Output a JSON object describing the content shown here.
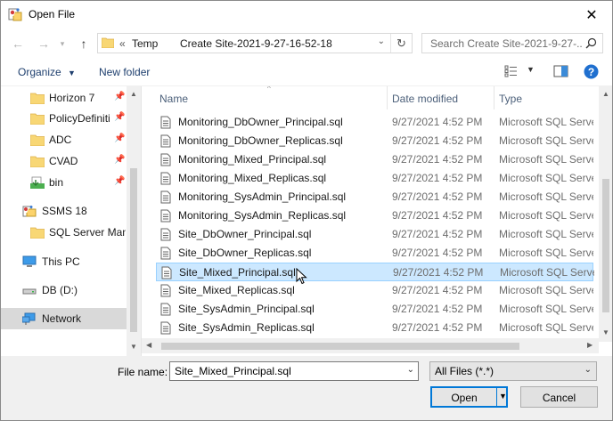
{
  "window": {
    "title": "Open File"
  },
  "address": {
    "prefix": "«",
    "segments": [
      "Temp",
      "Create Site-2021-9-27-16-52-18"
    ],
    "search_placeholder": "Search Create Site-2021-9-27-..."
  },
  "toolbar": {
    "organize": "Organize",
    "new_folder": "New folder"
  },
  "sidebar": {
    "items": [
      {
        "label": "Horizon 7",
        "icon": "folder-icon",
        "pinned": true
      },
      {
        "label": "PolicyDefiniti",
        "icon": "folder-icon",
        "pinned": true
      },
      {
        "label": "ADC",
        "icon": "folder-icon",
        "pinned": true
      },
      {
        "label": "CVAD",
        "icon": "folder-icon",
        "pinned": true
      },
      {
        "label": "bin",
        "icon": "green-folder-icon",
        "pinned": true
      },
      {
        "label": "SSMS 18",
        "icon": "ssms-icon",
        "pinned": false
      },
      {
        "label": "SQL Server Mana",
        "icon": "folder-icon",
        "pinned": false
      },
      {
        "label": "This PC",
        "icon": "computer-icon",
        "pinned": false
      },
      {
        "label": "DB (D:)",
        "icon": "drive-icon",
        "pinned": false
      },
      {
        "label": "Network",
        "icon": "network-icon",
        "pinned": false,
        "selected": true
      }
    ]
  },
  "filelist": {
    "columns": [
      "Name",
      "Date modified",
      "Type"
    ],
    "rows": [
      {
        "name": "Monitoring_DbOwner_Principal.sql",
        "date": "9/27/2021 4:52 PM",
        "type": "Microsoft SQL Server Query File"
      },
      {
        "name": "Monitoring_DbOwner_Replicas.sql",
        "date": "9/27/2021 4:52 PM",
        "type": "Microsoft SQL Server Query File"
      },
      {
        "name": "Monitoring_Mixed_Principal.sql",
        "date": "9/27/2021 4:52 PM",
        "type": "Microsoft SQL Server Query File"
      },
      {
        "name": "Monitoring_Mixed_Replicas.sql",
        "date": "9/27/2021 4:52 PM",
        "type": "Microsoft SQL Server Query File"
      },
      {
        "name": "Monitoring_SysAdmin_Principal.sql",
        "date": "9/27/2021 4:52 PM",
        "type": "Microsoft SQL Server Query File"
      },
      {
        "name": "Monitoring_SysAdmin_Replicas.sql",
        "date": "9/27/2021 4:52 PM",
        "type": "Microsoft SQL Server Query File"
      },
      {
        "name": "Site_DbOwner_Principal.sql",
        "date": "9/27/2021 4:52 PM",
        "type": "Microsoft SQL Server Query File"
      },
      {
        "name": "Site_DbOwner_Replicas.sql",
        "date": "9/27/2021 4:52 PM",
        "type": "Microsoft SQL Server Query File"
      },
      {
        "name": "Site_Mixed_Principal.sql",
        "date": "9/27/2021 4:52 PM",
        "type": "Microsoft SQL Server Query File",
        "selected": true
      },
      {
        "name": "Site_Mixed_Replicas.sql",
        "date": "9/27/2021 4:52 PM",
        "type": "Microsoft SQL Server Query File"
      },
      {
        "name": "Site_SysAdmin_Principal.sql",
        "date": "9/27/2021 4:52 PM",
        "type": "Microsoft SQL Server Query File"
      },
      {
        "name": "Site_SysAdmin_Replicas.sql",
        "date": "9/27/2021 4:52 PM",
        "type": "Microsoft SQL Server Query File"
      }
    ]
  },
  "footer": {
    "filename_label": "File name:",
    "filename_value": "Site_Mixed_Principal.sql",
    "filter_value": "All Files (*.*)",
    "open_label": "Open",
    "cancel_label": "Cancel"
  },
  "colors": {
    "accent": "#0078d7",
    "selection": "#cce8ff",
    "folder": "#f8d775"
  }
}
